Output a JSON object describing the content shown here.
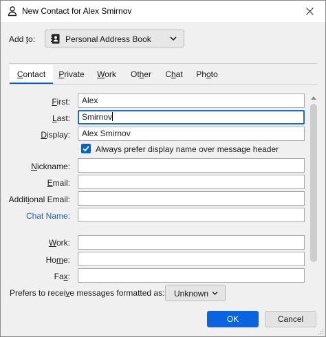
{
  "window": {
    "title": "New Contact for Alex Smirnov",
    "person_icon": "person-icon",
    "close_icon": "close-icon"
  },
  "addto": {
    "label_pre": "Add ",
    "label_u": "t",
    "label_post": "o:",
    "selected": "Personal Address Book",
    "icon": "address-book-icon"
  },
  "tabs": [
    {
      "pre": "",
      "u": "C",
      "post": "ontact",
      "active": true
    },
    {
      "pre": "",
      "u": "P",
      "post": "rivate"
    },
    {
      "pre": "",
      "u": "W",
      "post": "ork"
    },
    {
      "pre": "Ot",
      "u": "h",
      "post": "er"
    },
    {
      "pre": "C",
      "u": "h",
      "post": "at"
    },
    {
      "pre": "Ph",
      "u": "o",
      "post": "to"
    }
  ],
  "fields": {
    "first": {
      "pre": "",
      "u": "F",
      "post": "irst:",
      "value": "Alex"
    },
    "last": {
      "pre": "",
      "u": "L",
      "post": "ast:",
      "value": "Smirnov"
    },
    "display": {
      "pre": "",
      "u": "D",
      "post": "isplay:",
      "value": "Alex Smirnov"
    },
    "prefer_display": "Always prefer display name over message header",
    "nickname": {
      "pre": "",
      "u": "N",
      "post": "ickname:",
      "value": ""
    },
    "email": {
      "pre": "",
      "u": "E",
      "post": "mail:",
      "value": ""
    },
    "additional_email": {
      "pre": "Addit",
      "u": "i",
      "post": "onal Email:",
      "value": ""
    },
    "chat_name": {
      "label": "Chat Name:",
      "value": ""
    },
    "work": {
      "pre": "",
      "u": "W",
      "post": "ork:",
      "value": ""
    },
    "home": {
      "pre": "Ho",
      "u": "m",
      "post": "e:",
      "value": ""
    },
    "fax": {
      "pre": "Fa",
      "u": "x",
      "post": ":",
      "value": ""
    }
  },
  "format": {
    "pre": "Prefers to recei",
    "u": "v",
    "post": "e messages formatted as:",
    "value": "Unknown"
  },
  "buttons": {
    "ok": "OK",
    "cancel": "Cancel"
  },
  "colors": {
    "accent": "#0a64e0",
    "focus": "#1c6fc4",
    "link": "#1b63b5"
  }
}
